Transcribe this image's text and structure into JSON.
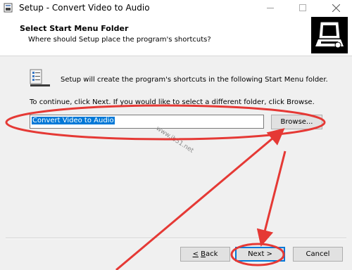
{
  "window": {
    "title": "Setup - Convert Video to Audio",
    "controls": [
      "minimize",
      "maximize",
      "close"
    ]
  },
  "header": {
    "title": "Select Start Menu Folder",
    "subtitle": "Where should Setup place the program's shortcuts?"
  },
  "content": {
    "info": "Setup will create the program's shortcuts in the following Start Menu folder.",
    "instruction": "To continue, click Next. If you would like to select a different folder, click Browse.",
    "folder_value": "Convert Video to Audio",
    "browse_label": "Browse..."
  },
  "watermark": "www.jb51.net",
  "footer": {
    "back_label": "< Back",
    "next_label": "Next >",
    "cancel_label": "Cancel"
  },
  "annotation_color": "#e53935"
}
